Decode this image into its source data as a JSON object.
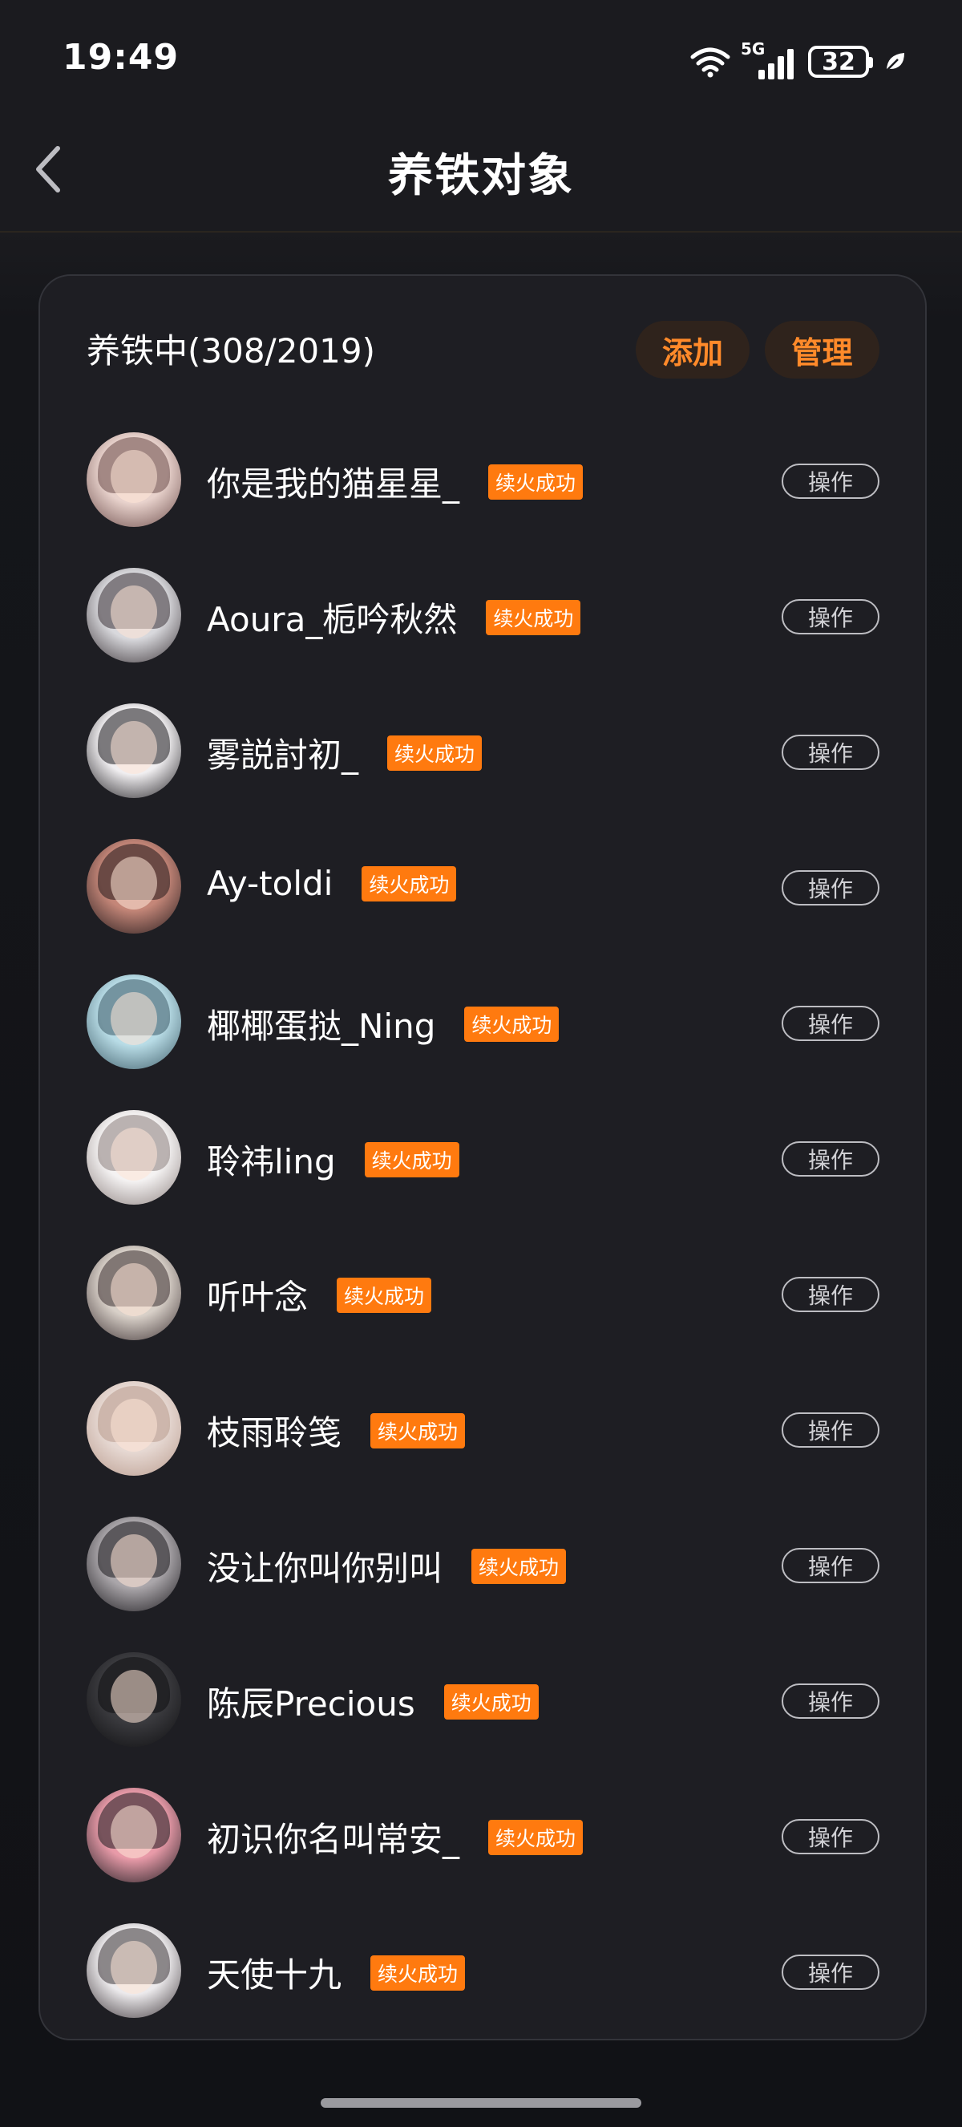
{
  "status_bar": {
    "time": "19:49",
    "network": "5G",
    "battery": "32",
    "icons": [
      "wifi-icon",
      "signal-icon",
      "battery-icon",
      "leaf-icon"
    ]
  },
  "header": {
    "title": "养铁对象",
    "back_icon": "chevron-left-icon"
  },
  "card": {
    "title": "养铁中(308/2019)",
    "add_label": "添加",
    "manage_label": "管理"
  },
  "colors": {
    "accent": "#ff7a0f",
    "accent_text": "#ff8a2a",
    "pill_bg": "#2f231c",
    "card_bg": "#1e1e23"
  },
  "rows": [
    {
      "name": "你是我的猫星星_",
      "badge": "续火成功",
      "action": "操作",
      "avatar_colors": [
        "#e8d2cc",
        "#6a4a48"
      ]
    },
    {
      "name": "Aoura_栀吟秋然",
      "badge": "续火成功",
      "action": "操作",
      "avatar_colors": [
        "#d8d8dc",
        "#3a3236"
      ]
    },
    {
      "name": "雾説討初_",
      "badge": "续火成功",
      "action": "操作",
      "avatar_colors": [
        "#f0eef0",
        "#1c1a1e"
      ]
    },
    {
      "name": "Ay-toldi",
      "badge": "续火成功",
      "action": "操作",
      "avatar_colors": [
        "#c48678",
        "#20181a"
      ]
    },
    {
      "name": "椰椰蛋挞_Ning",
      "badge": "续火成功",
      "action": "操作",
      "avatar_colors": [
        "#b8dce6",
        "#3c5a66"
      ]
    },
    {
      "name": "聆祎ling",
      "badge": "续火成功",
      "action": "操作",
      "avatar_colors": [
        "#f4f2f2",
        "#8a7e7c"
      ]
    },
    {
      "name": "听叶念",
      "badge": "续火成功",
      "action": "操作",
      "avatar_colors": [
        "#d8d0c8",
        "#3a2e30"
      ]
    },
    {
      "name": "枝雨聆笺",
      "badge": "续火成功",
      "action": "操作",
      "avatar_colors": [
        "#e6d8d2",
        "#b89a8c"
      ]
    },
    {
      "name": "没让你叫你别叫",
      "badge": "续火成功",
      "action": "操作",
      "avatar_colors": [
        "#aaa6aa",
        "#1a181c"
      ]
    },
    {
      "name": "陈辰Precious",
      "badge": "续火成功",
      "action": "操作",
      "avatar_colors": [
        "#3a3a3e",
        "#0e0e10"
      ]
    },
    {
      "name": "初识你名叫常安_",
      "badge": "续火成功",
      "action": "操作",
      "avatar_colors": [
        "#e89aa8",
        "#1a1a1e"
      ]
    },
    {
      "name": "天使十九",
      "badge": "续火成功",
      "action": "操作",
      "avatar_colors": [
        "#eceaec",
        "#3c3438"
      ]
    }
  ]
}
